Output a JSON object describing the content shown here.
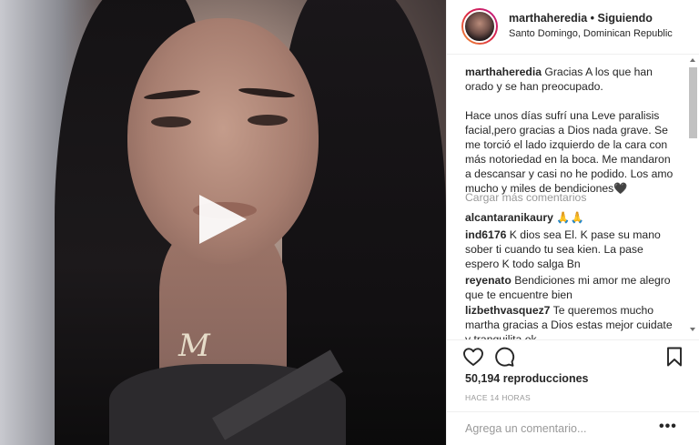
{
  "header": {
    "username": "marthaheredia",
    "separator": "•",
    "follow_status": "Siguiendo",
    "location": "Santo Domingo, Dominican Republic"
  },
  "caption": {
    "username": "marthaheredia",
    "paragraph1": "Gracias A los que han orado y se han preocupado.",
    "paragraph2": "Hace unos días sufrí una Leve paralisis facial,pero gracias a Dios nada grave. Se me torció el lado izquierdo de la cara con más notoriedad en la boca. Me mandaron a descansar y casi no he podido. Los amo mucho y miles de bendiciones🖤"
  },
  "load_more": "Cargar más comentarios",
  "comments": [
    {
      "username": "alcantaranikaury",
      "text": "🙏🙏"
    },
    {
      "username": "ind6176",
      "text": "K dios sea El. K pase su mano sober ti cuando tu sea kien. La pase espero K todo salga Bn"
    },
    {
      "username": "reyenato",
      "text": "Bendiciones mi amor me alegro que te encuentre bien"
    },
    {
      "username": "lizbethvasquez7",
      "text": "Te queremos mucho martha gracias a Dios estas mejor cuidate y tranquilita ok"
    }
  ],
  "actions": {
    "like_icon": "heart-icon",
    "comment_icon": "speech-bubble-icon",
    "save_icon": "bookmark-icon"
  },
  "stats": {
    "views": "50,194 reproducciones",
    "time_ago": "HACE 14 HORAS"
  },
  "add_comment": {
    "placeholder": "Agrega un comentario...",
    "more_label": "•••"
  },
  "media": {
    "pendant_letter": "M",
    "play_icon": "play-icon"
  }
}
